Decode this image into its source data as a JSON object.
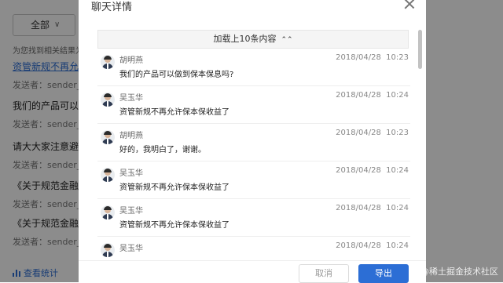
{
  "background": {
    "filter_label": "全部",
    "summary": "为您找到相关结果为",
    "items": [
      {
        "title": "资管新规不再允许",
        "sender": "发送者：sender_us"
      },
      {
        "title": "我们的产品可以做",
        "sender": "发送者：sender_us"
      },
      {
        "title": "请大大家注意避免",
        "sender": "发送者：sender_us"
      },
      {
        "title": "《关于规范金融机",
        "sender": "发送者：sender_us"
      },
      {
        "title": "《关于规范金融机",
        "sender": "发送者：sender_us"
      }
    ],
    "stats_label": "查看统计"
  },
  "modal": {
    "title": "聊天详情",
    "load_more": "加载上10条内容",
    "messages": [
      {
        "name": "胡明燕",
        "date": "2018/04/28",
        "time": "10:23",
        "text": "我们的产品可以做到保本保息吗?"
      },
      {
        "name": "吴玉华",
        "date": "2018/04/28",
        "time": "10:24",
        "text": "资管新规不再允许保本保收益了"
      },
      {
        "name": "胡明燕",
        "date": "2018/04/28",
        "time": "10:23",
        "text": "好的，我明白了，谢谢。"
      },
      {
        "name": "吴玉华",
        "date": "2018/04/28",
        "time": "10:24",
        "text": "资管新规不再允许保本保收益了"
      },
      {
        "name": "吴玉华",
        "date": "2018/04/28",
        "time": "10:24",
        "text": "资管新规不再允许保本保收益了"
      },
      {
        "name": "吴玉华",
        "date": "2018/04/28",
        "time": "10:24",
        "text": ""
      }
    ],
    "cancel_label": "取消",
    "export_label": "导出"
  },
  "watermark": "@稀土掘金技术社区",
  "colors": {
    "accent": "#2c6ed5",
    "overlay": "rgba(0,0,0,0.45)"
  }
}
